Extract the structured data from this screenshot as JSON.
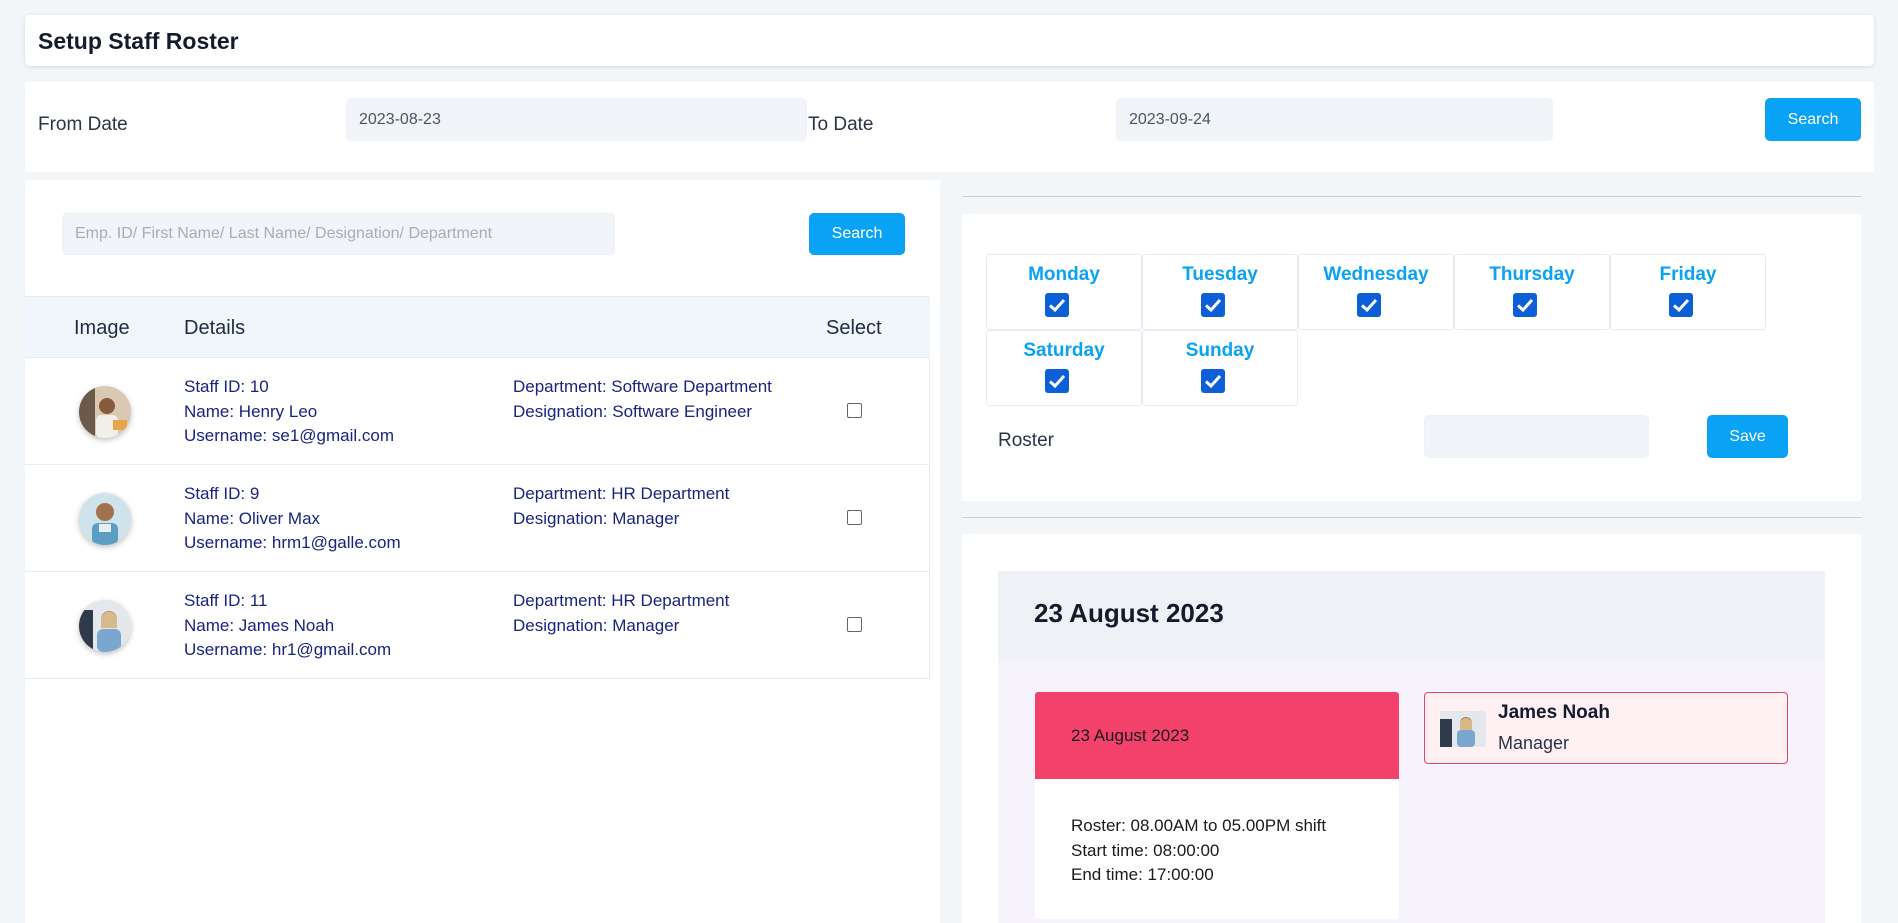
{
  "page": {
    "title": "Setup Staff Roster"
  },
  "date_filter": {
    "from_label": "From Date",
    "from_value": "2023-08-23",
    "to_label": "To Date",
    "to_value": "2023-09-24",
    "search_label": "Search"
  },
  "employee_search": {
    "placeholder": "Emp. ID/ First Name/ Last Name/ Designation/ Department",
    "search_label": "Search"
  },
  "table": {
    "headers": {
      "image": "Image",
      "details": "Details",
      "select": "Select"
    },
    "rows": [
      {
        "staff_id": "Staff ID: 10",
        "name": "Name: Henry Leo",
        "username": "Username: se1@gmail.com",
        "department": "Department: Software Department",
        "designation": "Designation: Software Engineer",
        "checked": false
      },
      {
        "staff_id": "Staff ID: 9",
        "name": "Name: Oliver Max",
        "username": "Username: hrm1@galle.com",
        "department": "Department: HR Department",
        "designation": "Designation: Manager",
        "checked": false
      },
      {
        "staff_id": "Staff ID: 11",
        "name": "Name: James Noah",
        "username": "Username: hr1@gmail.com",
        "department": "Department: HR Department",
        "designation": "Designation: Manager",
        "checked": false
      }
    ]
  },
  "days": [
    {
      "label": "Monday",
      "checked": true
    },
    {
      "label": "Tuesday",
      "checked": true
    },
    {
      "label": "Wednesday",
      "checked": true
    },
    {
      "label": "Thursday",
      "checked": true
    },
    {
      "label": "Friday",
      "checked": true
    },
    {
      "label": "Saturday",
      "checked": true
    },
    {
      "label": "Sunday",
      "checked": true
    }
  ],
  "roster": {
    "label": "Roster",
    "value": "",
    "save_label": "Save"
  },
  "calendar": {
    "heading": "23 August 2023",
    "event": {
      "date": "23 August 2023",
      "roster": "Roster: 08.00AM to 05.00PM shift",
      "start": "Start time: 08:00:00",
      "end": "End time: 17:00:00"
    },
    "staff": {
      "name": "James Noah",
      "role": "Manager"
    }
  },
  "colors": {
    "accent": "#0aa2f5",
    "checkbox": "#0d5fd8",
    "event": "#f2426b",
    "text_navy": "#1a237e"
  }
}
